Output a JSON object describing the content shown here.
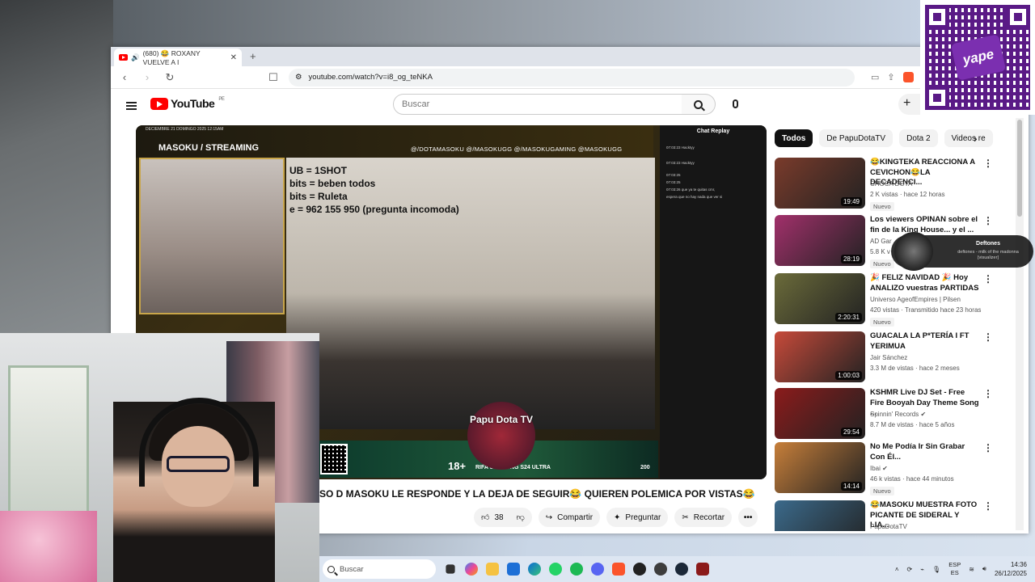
{
  "browser": {
    "tab_title": "(680) 😂 ROXANY VUELVE A I",
    "tab_count_prefix": "",
    "new_tab": "+",
    "url": "youtube.com/watch?v=i8_og_teNKA"
  },
  "youtube": {
    "logo_text": "YouTube",
    "region": "PE",
    "search_placeholder": "Buscar",
    "create_label": "+"
  },
  "player": {
    "stream_date": "DECIEMBRE 21 DOMINGO 2025 12:15AM",
    "stream_title": "MASOKU / STREAMING",
    "socials": "@/DOTAMASOKU  @/MASOKUGG  @/MASOKUGAMING  @MASOKUGG",
    "overlay_lines": [
      "UB = 1SHOT",
      "bits = beben todos",
      "bits = Ruleta",
      "e = 962 155 950 (pregunta incomoda)"
    ],
    "chat_title": "Chat Replay",
    "chat_lines": [
      "07:03:23 Hacktyy",
      "07:03:23 Hacktyy",
      "07:03:25",
      "07:03:25",
      "07:03:26 que ya te quitas cmr,",
      "espera que no hay nada que ver si"
    ],
    "logo": "Papu Dota TV",
    "eighteen": "18+",
    "rifa": "RIFA SAMSUNG S24 ULTRA",
    "rifa_num": "200"
  },
  "video": {
    "title": "SO D MASOKU LE RESPONDE Y LA DEJA DE SEGUIR😂 QUIEREN POLEMICA POR VISTAS😂",
    "likes": "38",
    "share": "Compartir",
    "ask": "Preguntar",
    "clip": "Recortar",
    "more": "•••"
  },
  "chips": [
    "Todos",
    "De PapuDotaTV",
    "Dota 2",
    "Videos re"
  ],
  "chip_next": "›",
  "recommendations": [
    {
      "title": "😂KINGTEKA REACCIONA A CEVICHON😂LA DECADENCI...",
      "channel": "CHOCA DOTA",
      "meta": "2 K vistas · hace 12 horas",
      "badge": "Nuevo",
      "duration": "19:49",
      "color": "#7a3b2b"
    },
    {
      "title": "Los viewers OPINAN sobre el fin de la King House... y el ...",
      "channel": "AD Gar",
      "meta": "5.8 K v",
      "badge": "Nuevo",
      "duration": "28:19",
      "color": "#a2306b"
    },
    {
      "title": "🎉 FELIZ NAVIDAD 🎉 Hoy ANALIZO vuestras PARTIDAS",
      "channel": "Universo AgeofEmpires | Pilsen",
      "meta": "420 vistas · Transmitido hace 23 horas",
      "badge": "Nuevo",
      "duration": "2:20:31",
      "color": "#6b6b3a"
    },
    {
      "title": "GUACALA LA P*TERÍA I FT YERIMUA",
      "channel": "Jair Sánchez",
      "meta": "3.3 M de vistas · hace 2 meses",
      "badge": "",
      "duration": "1:00:03",
      "color": "#c74a3a"
    },
    {
      "title": "KSHMR Live DJ Set - Free Fire Booyah Day Theme Song ...",
      "channel": "Spinnin' Records ✔",
      "meta": "8.7 M de vistas · hace 5 años",
      "badge": "",
      "duration": "29:54",
      "color": "#8b1b1b"
    },
    {
      "title": "No Me Podía Ir Sin Grabar Con Él...",
      "channel": "Ibai ✔",
      "meta": "46 k vistas · hace 44 minutos",
      "badge": "Nuevo",
      "duration": "14:14",
      "color": "#c77f3a"
    },
    {
      "title": "😂MASOKU MUESTRA FOTO PICANTE DE SIDERAL Y LIA...",
      "channel": "PapuDotaTV",
      "meta": "",
      "badge": "",
      "duration": "",
      "color": "#3b6a8b"
    }
  ],
  "music": {
    "title": "Deftones",
    "subtitle": "deftones - milk of the madonna [visualizer]"
  },
  "qr": {
    "brand": "yape"
  },
  "taskbar": {
    "search": "Buscar",
    "lang_top": "ESP",
    "lang_bottom": "ES",
    "time": "14:36",
    "date": "26/12/2025"
  }
}
